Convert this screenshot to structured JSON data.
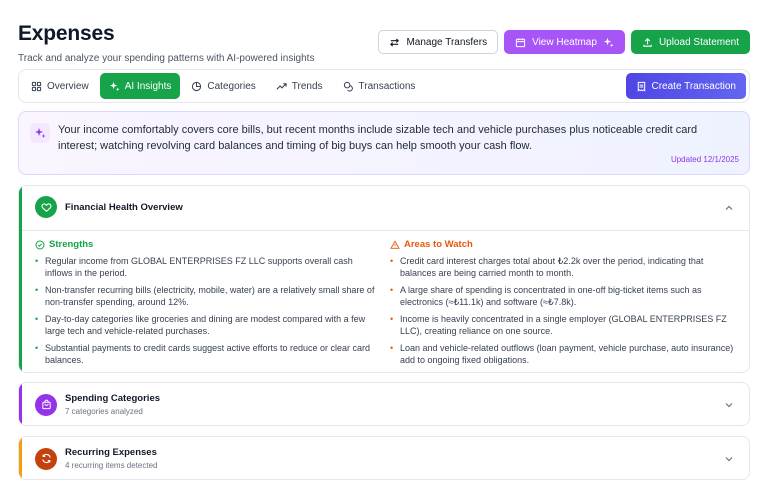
{
  "header": {
    "title": "Expenses",
    "subtitle": "Track and analyze your spending patterns with AI-powered insights"
  },
  "actions": {
    "manage_transfers": "Manage Transfers",
    "view_heatmap": "View Heatmap",
    "upload_statement": "Upload Statement"
  },
  "tabs": [
    {
      "label": "Overview",
      "icon": "grid-icon"
    },
    {
      "label": "AI Insights",
      "icon": "sparkles-icon",
      "active": true
    },
    {
      "label": "Categories",
      "icon": "pie-chart-icon"
    },
    {
      "label": "Trends",
      "icon": "trending-up-icon"
    },
    {
      "label": "Transactions",
      "icon": "coins-icon"
    }
  ],
  "create_transaction": "Create Transaction",
  "insight": {
    "text": "Your income comfortably covers core bills, but recent months include sizable tech and vehicle purchases plus noticeable credit card interest; watching revolving card balances and timing of big buys can help smooth your cash flow.",
    "updated": "Updated 12/1/2025"
  },
  "health": {
    "title": "Financial Health Overview",
    "strengths_title": "Strengths",
    "strengths": [
      "Regular income from GLOBAL ENTERPRISES FZ LLC supports overall cash inflows in the period.",
      "Non-transfer recurring bills (electricity, mobile, water) are a relatively small share of non-transfer spending, around 12%.",
      "Day-to-day categories like groceries and dining are modest compared with a few large tech and vehicle-related purchases.",
      "Substantial payments to credit cards suggest active efforts to reduce or clear card balances."
    ],
    "watch_title": "Areas to Watch",
    "watch": [
      "Credit card interest charges total about ₺2.2k over the period, indicating that balances are being carried month to month.",
      "A large share of spending is concentrated in one-off big-ticket items such as electronics (≈₺11.1k) and software (≈₺7.8k).",
      "Income is heavily concentrated in a single employer (GLOBAL ENTERPRISES FZ LLC), creating reliance on one source.",
      "Loan and vehicle-related outflows (loan payment, vehicle purchase, auto insurance) add to ongoing fixed obligations."
    ]
  },
  "spending": {
    "title": "Spending Categories",
    "subtitle": "7 categories analyzed"
  },
  "recurring": {
    "title": "Recurring Expenses",
    "subtitle": "4 recurring items detected"
  },
  "colors": {
    "green": "#16a34a",
    "purple": "#a855f7",
    "indigo": "#4f46e5",
    "orange": "#ea580c"
  }
}
